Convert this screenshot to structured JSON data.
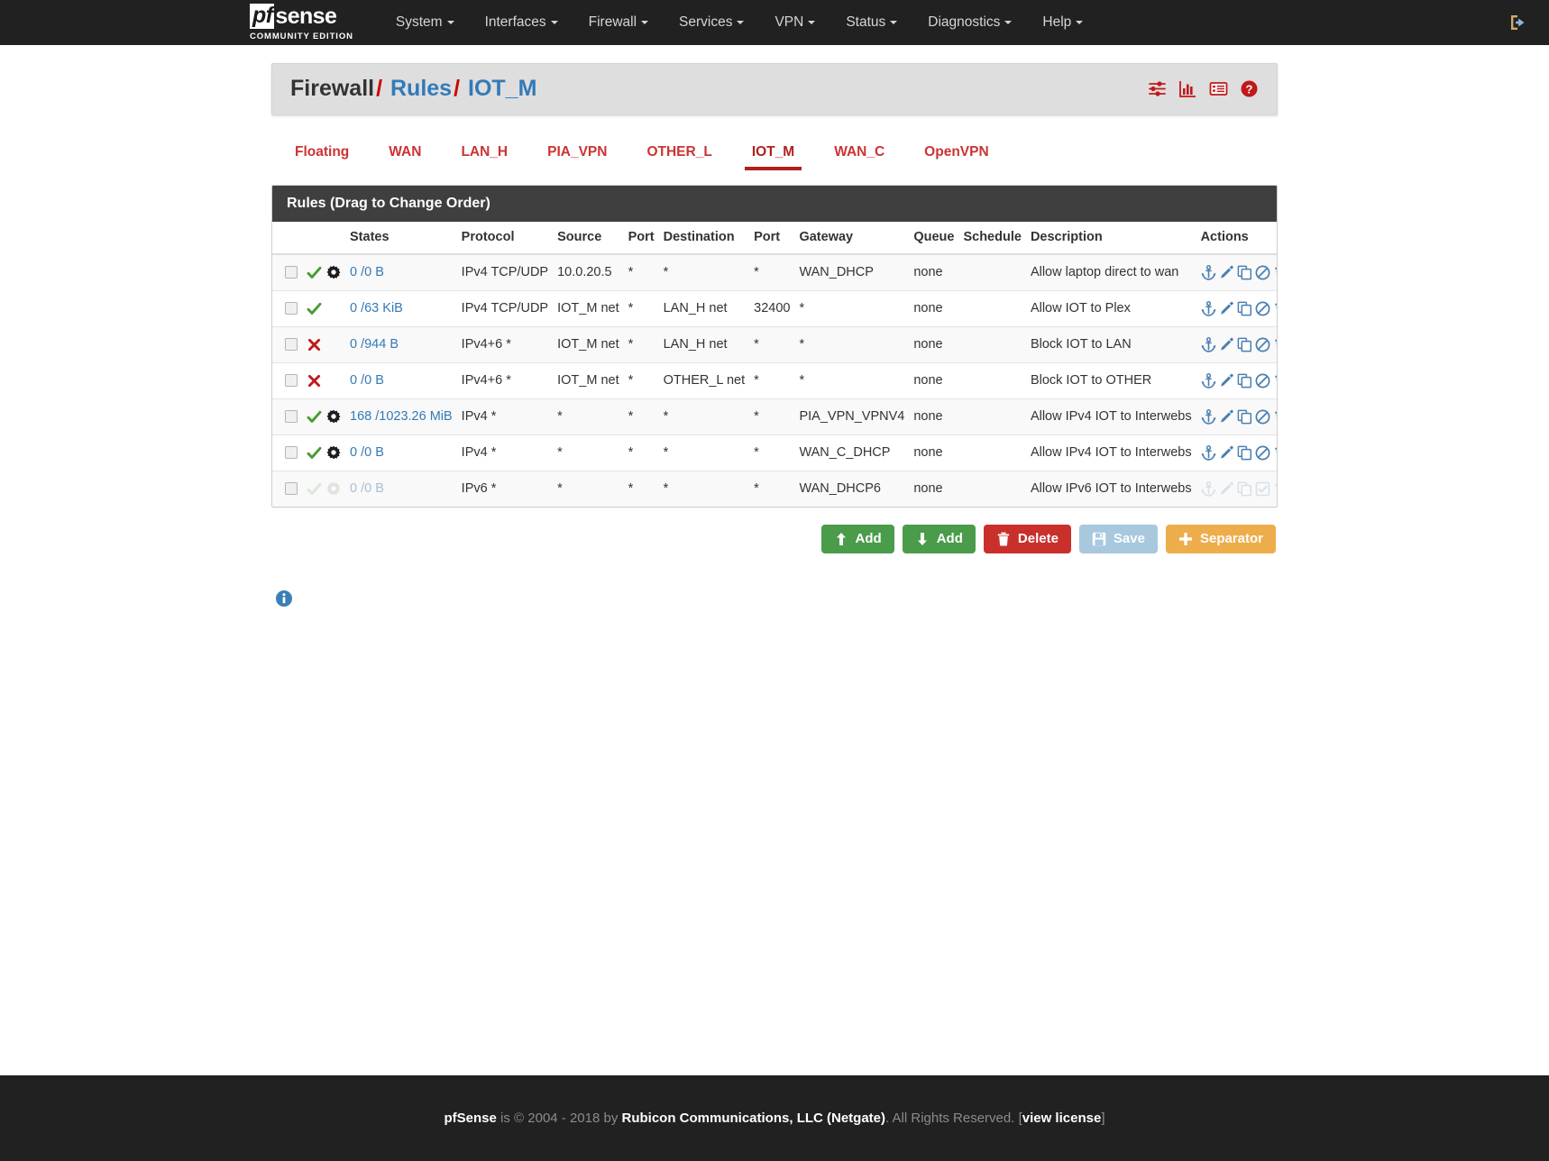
{
  "navbar": {
    "brand": {
      "pf": "pf",
      "sense": "sense",
      "subtitle": "COMMUNITY EDITION"
    },
    "items": [
      {
        "label": "System",
        "caret": true
      },
      {
        "label": "Interfaces",
        "caret": true
      },
      {
        "label": "Firewall",
        "caret": true
      },
      {
        "label": "Services",
        "caret": true
      },
      {
        "label": "VPN",
        "caret": true
      },
      {
        "label": "Status",
        "caret": true
      },
      {
        "label": "Diagnostics",
        "caret": true
      },
      {
        "label": "Help",
        "caret": true
      }
    ],
    "logout_icon": "logout-icon"
  },
  "page_header": {
    "crumb1": "Firewall",
    "sep1": "/",
    "crumb2": "Rules",
    "sep2": "/",
    "crumb3": "IOT_M",
    "icons": [
      {
        "name": "filter-sliders-icon"
      },
      {
        "name": "bar-chart-icon"
      },
      {
        "name": "log-list-icon"
      },
      {
        "name": "help-circle-icon"
      }
    ]
  },
  "tabs": [
    {
      "label": "Floating",
      "active": false
    },
    {
      "label": "WAN",
      "active": false
    },
    {
      "label": "LAN_H",
      "active": false
    },
    {
      "label": "PIA_VPN",
      "active": false
    },
    {
      "label": "OTHER_L",
      "active": false
    },
    {
      "label": "IOT_M",
      "active": true
    },
    {
      "label": "WAN_C",
      "active": false
    },
    {
      "label": "OpenVPN",
      "active": false
    }
  ],
  "panel": {
    "heading": "Rules (Drag to Change Order)",
    "columns": [
      "",
      "",
      "States",
      "Protocol",
      "Source",
      "Port",
      "Destination",
      "Port",
      "Gateway",
      "Queue",
      "Schedule",
      "Description",
      "Actions"
    ],
    "rows": [
      {
        "status": "pass",
        "advanced": true,
        "disabled": false,
        "states": "0 /0 B",
        "protocol": "IPv4 TCP/UDP",
        "source": "10.0.20.5",
        "source_port": "*",
        "destination": "*",
        "dest_port": "*",
        "gateway": "WAN_DHCP",
        "queue": "none",
        "schedule": "",
        "description": "Allow laptop direct to wan",
        "actions": [
          "anchor-icon",
          "edit-pencil-icon",
          "copy-icon",
          "disable-ban-icon",
          "delete-trash-icon"
        ]
      },
      {
        "status": "pass",
        "advanced": false,
        "disabled": false,
        "states": "0 /63 KiB",
        "protocol": "IPv4 TCP/UDP",
        "source": "IOT_M net",
        "source_port": "*",
        "destination": "LAN_H net",
        "dest_port": "32400",
        "gateway": "*",
        "queue": "none",
        "schedule": "",
        "description": "Allow IOT to Plex",
        "actions": [
          "anchor-icon",
          "edit-pencil-icon",
          "copy-icon",
          "disable-ban-icon",
          "delete-trash-icon"
        ]
      },
      {
        "status": "block",
        "advanced": false,
        "disabled": false,
        "states": "0 /944 B",
        "protocol": "IPv4+6 *",
        "source": "IOT_M net",
        "source_port": "*",
        "destination": "LAN_H net",
        "dest_port": "*",
        "gateway": "*",
        "queue": "none",
        "schedule": "",
        "description": "Block IOT to LAN",
        "actions": [
          "anchor-icon",
          "edit-pencil-icon",
          "copy-icon",
          "disable-ban-icon",
          "delete-trash-icon"
        ]
      },
      {
        "status": "block",
        "advanced": false,
        "disabled": false,
        "states": "0 /0 B",
        "protocol": "IPv4+6 *",
        "source": "IOT_M net",
        "source_port": "*",
        "destination": "OTHER_L net",
        "dest_port": "*",
        "gateway": "*",
        "queue": "none",
        "schedule": "",
        "description": "Block IOT to OTHER",
        "actions": [
          "anchor-icon",
          "edit-pencil-icon",
          "copy-icon",
          "disable-ban-icon",
          "delete-trash-icon"
        ]
      },
      {
        "status": "pass",
        "advanced": true,
        "disabled": false,
        "states": "168 /1023.26 MiB",
        "protocol": "IPv4 *",
        "source": "*",
        "source_port": "*",
        "destination": "*",
        "dest_port": "*",
        "gateway": "PIA_VPN_VPNV4",
        "queue": "none",
        "schedule": "",
        "description": "Allow IPv4 IOT to Interwebs",
        "actions": [
          "anchor-icon",
          "edit-pencil-icon",
          "copy-icon",
          "disable-ban-icon",
          "delete-trash-icon"
        ]
      },
      {
        "status": "pass",
        "advanced": true,
        "disabled": false,
        "states": "0 /0 B",
        "protocol": "IPv4 *",
        "source": "*",
        "source_port": "*",
        "destination": "*",
        "dest_port": "*",
        "gateway": "WAN_C_DHCP",
        "queue": "none",
        "schedule": "",
        "description": "Allow IPv4 IOT to Interwebs",
        "actions": [
          "anchor-icon",
          "edit-pencil-icon",
          "copy-icon",
          "disable-ban-icon",
          "delete-trash-icon"
        ]
      },
      {
        "status": "pass",
        "advanced": true,
        "disabled": true,
        "states": "0 /0 B",
        "protocol": "IPv6 *",
        "source": "*",
        "source_port": "*",
        "destination": "*",
        "dest_port": "*",
        "gateway": "WAN_DHCP6",
        "queue": "none",
        "schedule": "",
        "description": "Allow IPv6 IOT to Interwebs",
        "actions": [
          "anchor-icon",
          "edit-pencil-icon",
          "copy-icon",
          "enable-check-square-icon",
          "delete-trash-icon"
        ]
      }
    ]
  },
  "buttons": [
    {
      "label": "Add",
      "icon": "arrow-up-icon",
      "style": "success",
      "name": "add-rule-top-button"
    },
    {
      "label": "Add",
      "icon": "arrow-down-icon",
      "style": "success",
      "name": "add-rule-bottom-button"
    },
    {
      "label": "Delete",
      "icon": "trash-icon",
      "style": "danger",
      "name": "delete-button"
    },
    {
      "label": "Save",
      "icon": "floppy-save-icon",
      "style": "info",
      "name": "save-button"
    },
    {
      "label": "Separator",
      "icon": "plus-icon",
      "style": "warning",
      "name": "separator-button"
    }
  ],
  "info_icon": "info-circle-icon",
  "footer": {
    "brand": "pfSense",
    "text1": " is © 2004 - 2018 by ",
    "company": "Rubicon Communications, LLC (Netgate)",
    "text2": ". All Rights Reserved. [",
    "license": "view license",
    "text3": "]"
  },
  "colors": {
    "navbar_bg": "#212121",
    "brand_red": "#b02020",
    "link_blue": "#337ab7",
    "pass_green": "#4a9c30",
    "block_red": "#c0191b",
    "panel_heading": "#3f3f3f",
    "btn_success": "#4a9c4a",
    "btn_danger": "#c9302c",
    "btn_info": "#a8c8de",
    "btn_warning": "#eead4b"
  }
}
